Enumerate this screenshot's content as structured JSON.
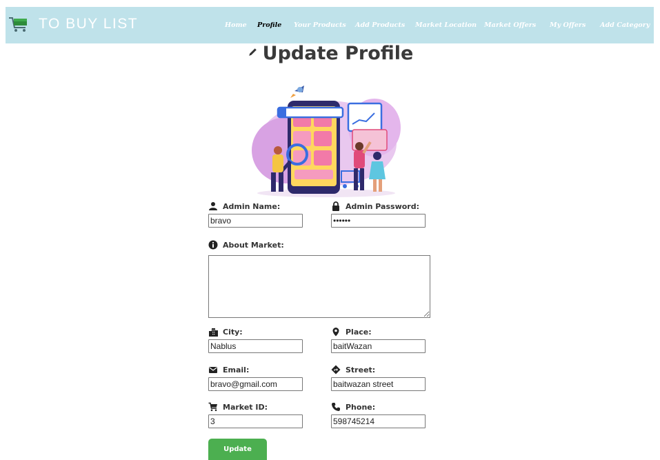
{
  "brand": {
    "name": "TO BUY LIST",
    "icon": "shopping-cart-icon"
  },
  "nav": {
    "items": [
      "Home",
      "Profile",
      "Your Products",
      "Add Products",
      "Market Location",
      "Market Offers",
      "My Offers",
      "Add Category"
    ],
    "active": "Profile"
  },
  "page": {
    "title": "Update Profile",
    "title_icon": "pencil-icon"
  },
  "form": {
    "admin_name": {
      "label": "Admin Name:",
      "value": "bravo",
      "icon": "person-icon"
    },
    "admin_password": {
      "label": "Admin Password:",
      "value": "••••••",
      "icon": "lock-icon"
    },
    "about_market": {
      "label": "About Market:",
      "value": "",
      "icon": "info-icon"
    },
    "city": {
      "label": "City:",
      "value": "Nablus",
      "icon": "city-icon"
    },
    "place": {
      "label": "Place:",
      "value": "baitWazan",
      "icon": "location-pin-icon"
    },
    "email": {
      "label": "Email:",
      "value": "bravo@gmail.com",
      "icon": "envelope-icon"
    },
    "street": {
      "label": "Street:",
      "value": "baitwazan street",
      "icon": "directions-icon"
    },
    "market_id": {
      "label": "Market ID:",
      "value": "3",
      "icon": "cart-icon"
    },
    "phone": {
      "label": "Phone:",
      "value": "598745214",
      "icon": "phone-icon"
    },
    "submit_label": "Update"
  },
  "colors": {
    "navbar": "#bfe2ea",
    "button": "#4caf50",
    "active_nav": "#000000"
  }
}
